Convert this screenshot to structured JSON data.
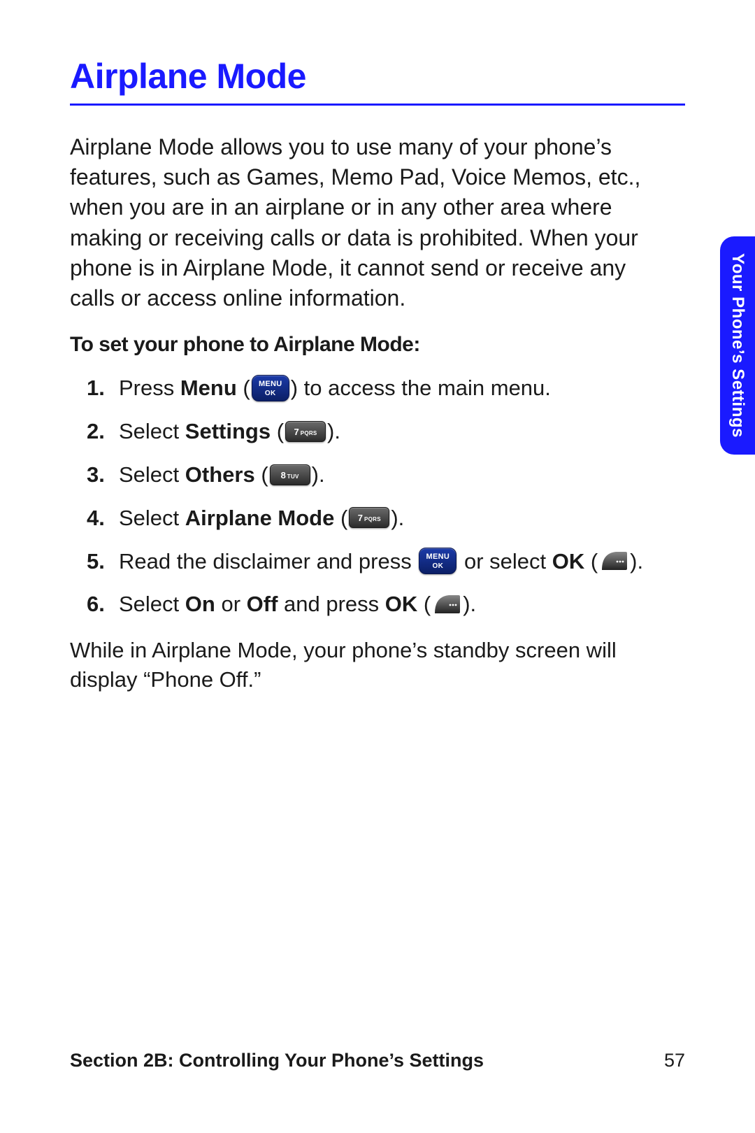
{
  "heading": "Airplane Mode",
  "intro": "Airplane Mode allows you to use many of your phone’s features, such as Games, Memo Pad, Voice Memos, etc., when you are in an airplane or in any other area where making or receiving calls or data is prohibited. When your phone is in Airplane Mode, it cannot send or receive any calls or access online information.",
  "sub_heading": "To set your phone to Airplane Mode:",
  "steps": {
    "s1": {
      "pre": "Press ",
      "bold1": "Menu",
      "post": " to access the main menu."
    },
    "s2": {
      "pre": "Select ",
      "bold1": "Settings"
    },
    "s3": {
      "pre": "Select ",
      "bold1": "Others"
    },
    "s4": {
      "pre": "Select ",
      "bold1": "Airplane Mode"
    },
    "s5": {
      "pre": "Read the disclaimer and press ",
      "mid": " or select ",
      "bold1": "OK"
    },
    "s6": {
      "pre": "Select ",
      "bold1": "On",
      "mid": " or ",
      "bold2": "Off",
      "mid2": " and press ",
      "bold3": "OK"
    }
  },
  "keys": {
    "menu_top": "MENU",
    "k7": "7",
    "k7_sub": "PQRS",
    "k8": "8",
    "k8_sub": "TUV"
  },
  "closing": "While in Airplane Mode, your phone’s standby screen will display “Phone Off.”",
  "side_tab": "Your Phone’s Settings",
  "footer": {
    "section": "Section 2B: Controlling Your Phone’s Settings",
    "page": "57"
  }
}
